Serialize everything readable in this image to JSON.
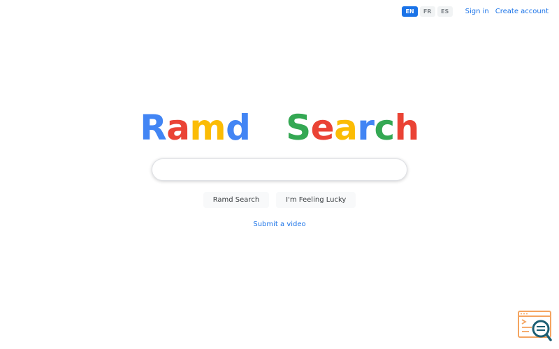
{
  "header": {
    "languages": [
      {
        "code": "EN",
        "active": true
      },
      {
        "code": "FR",
        "active": false
      },
      {
        "code": "ES",
        "active": false
      }
    ],
    "sign_in": "Sign in",
    "create_account": "Create account"
  },
  "logo": {
    "letters": [
      {
        "char": "R",
        "color": "#4285f4"
      },
      {
        "char": "a",
        "color": "#ea4335"
      },
      {
        "char": "m",
        "color": "#fbbc05"
      },
      {
        "char": "d",
        "color": "#4285f4"
      },
      {
        "char": "   ",
        "color": "#ffffff"
      },
      {
        "char": "S",
        "color": "#34a853"
      },
      {
        "char": "e",
        "color": "#ea4335"
      },
      {
        "char": "a",
        "color": "#fbbc05"
      },
      {
        "char": "r",
        "color": "#4285f4"
      },
      {
        "char": "c",
        "color": "#34a853"
      },
      {
        "char": "h",
        "color": "#ea4335"
      }
    ]
  },
  "search": {
    "value": "",
    "placeholder": ""
  },
  "buttons": {
    "search": "Ramd Search",
    "lucky": "I'm Feeling Lucky"
  },
  "submit_video": "Submit a video",
  "widget": {
    "icon": "terminal-search-icon",
    "colors": {
      "frame": "#f4a460",
      "lens": "#1b5e73"
    }
  },
  "colors": {
    "accent": "#1a73e8",
    "background": "#ffffff"
  }
}
